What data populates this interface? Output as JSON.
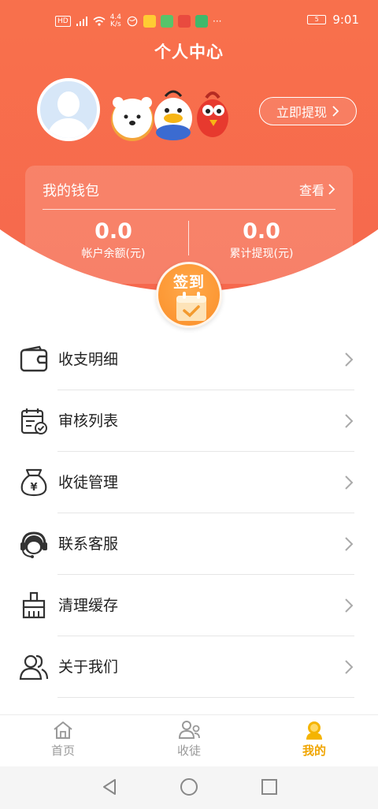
{
  "status_bar": {
    "left_icons": [
      "hd-icon",
      "signal-4g-icon",
      "wifi-icon",
      "network-speed-icon",
      "app-notification-icons",
      "more-dots-icon"
    ],
    "hd": "HD",
    "net_speed_value": "4.4",
    "net_speed_unit": "K/s",
    "battery": "5",
    "time": "9:01"
  },
  "header": {
    "title": "个人中心",
    "withdraw_button": "立即提现"
  },
  "wallet": {
    "title": "我的钱包",
    "view_link": "查看",
    "balance_value": "0.0",
    "balance_label": "帐户余额(元)",
    "total_value": "0.0",
    "total_label": "累计提现(元)"
  },
  "checkin": {
    "label": "签到"
  },
  "menu": {
    "items": [
      {
        "label": "收支明细",
        "icon": "wallet-icon"
      },
      {
        "label": "审核列表",
        "icon": "calendar-check-icon"
      },
      {
        "label": "收徒管理",
        "icon": "money-bag-icon"
      },
      {
        "label": "联系客服",
        "icon": "headset-icon"
      },
      {
        "label": "清理缓存",
        "icon": "broom-icon"
      },
      {
        "label": "关于我们",
        "icon": "users-icon"
      }
    ]
  },
  "tabbar": {
    "tabs": [
      {
        "label": "首页",
        "icon": "home-icon"
      },
      {
        "label": "收徒",
        "icon": "apprentice-icon"
      },
      {
        "label": "我的",
        "icon": "profile-icon",
        "active": true
      }
    ]
  },
  "colors": {
    "header_gradient_top": "#fb8a4e",
    "header_gradient_bottom": "#f6684d",
    "checkin_orange": "#fb8f2a",
    "active_tab": "#f0a500"
  }
}
